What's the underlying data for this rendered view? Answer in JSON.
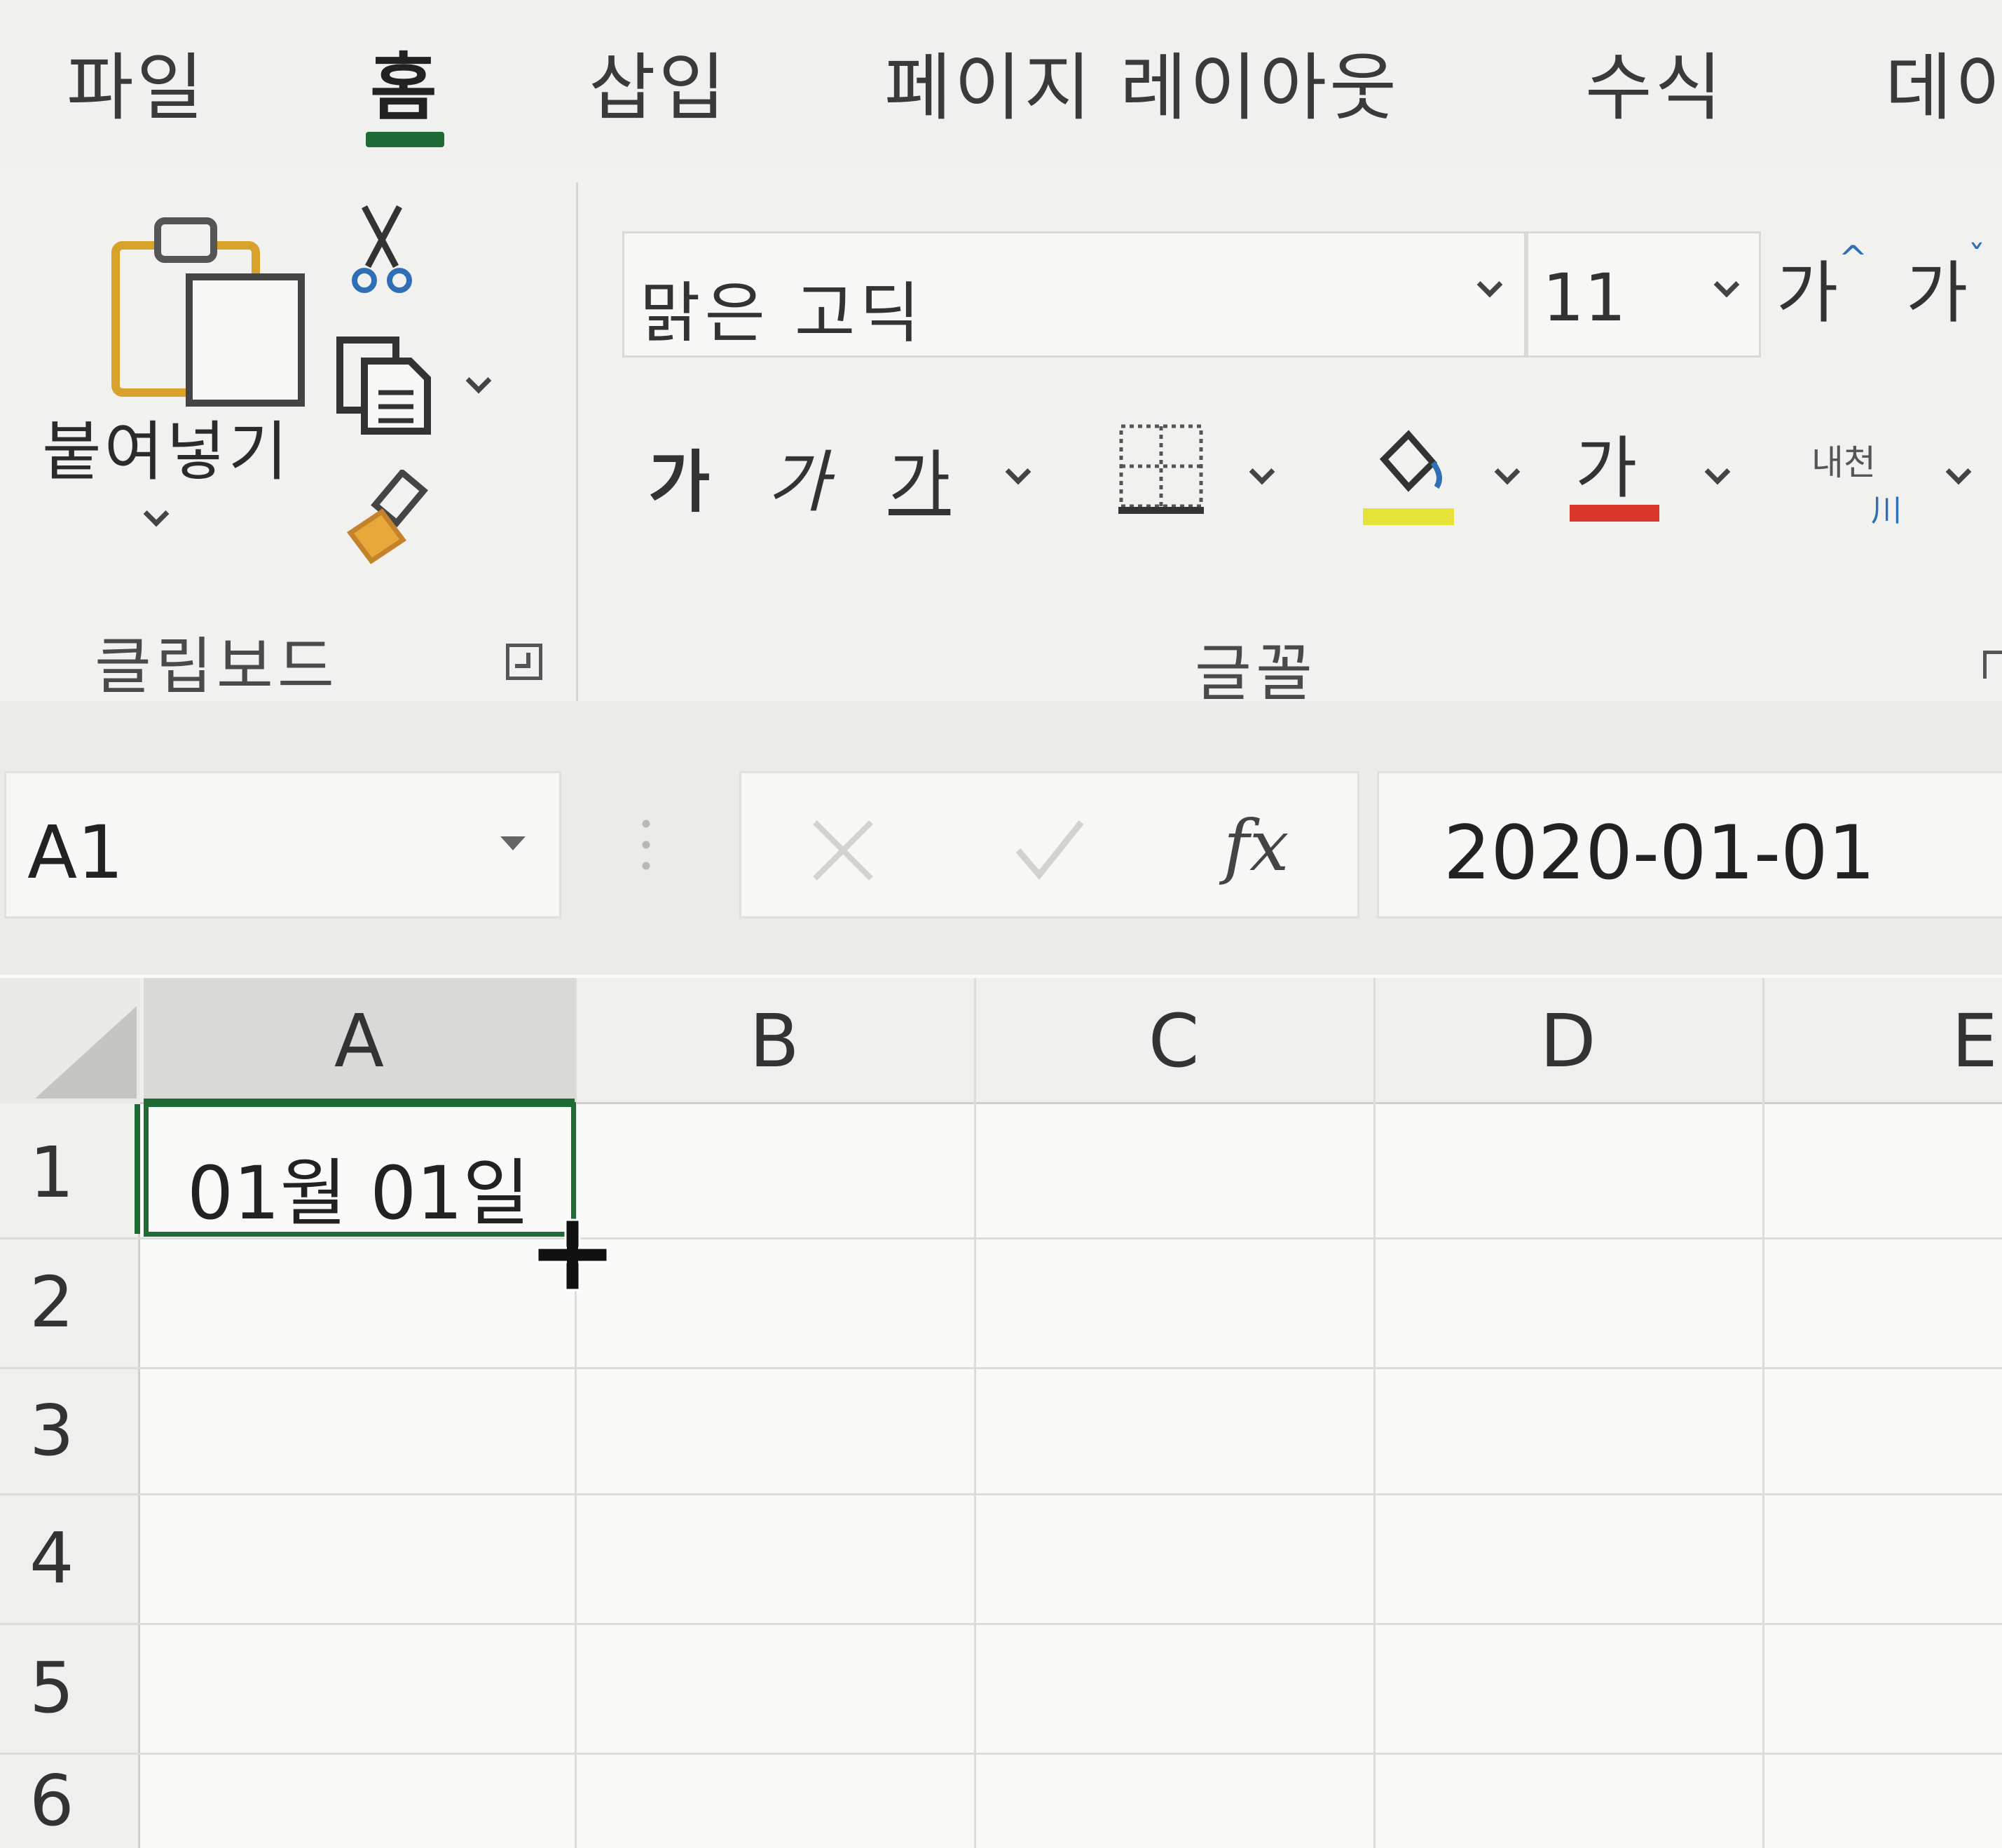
{
  "tabs": [
    {
      "label": "파일",
      "active": false
    },
    {
      "label": "홈",
      "active": true
    },
    {
      "label": "삽입",
      "active": false
    },
    {
      "label": "페이지 레이아웃",
      "active": false
    },
    {
      "label": "수식",
      "active": false
    },
    {
      "label": "데이",
      "active": false
    }
  ],
  "clipboard": {
    "paste_label": "붙여넣기",
    "group_label": "클립보드",
    "icons": [
      "paste-icon",
      "cut-icon",
      "copy-icon",
      "format-painter-icon"
    ]
  },
  "font": {
    "font_name": "맑은 고딕",
    "font_size": "11",
    "grow_label": "가",
    "shrink_label": "가",
    "bold_label": "가",
    "italic_label": "가",
    "underline_label": "가",
    "font_color_label": "가",
    "phonetic_label": "내천",
    "group_label": "글꼴",
    "fill_color": "#e6e23a",
    "font_color": "#d9362b"
  },
  "formula_bar": {
    "name_box": "A1",
    "formula_value": "2020-01-01",
    "fx_label": "fx"
  },
  "sheet": {
    "columns": [
      "A",
      "B",
      "C",
      "D",
      "E"
    ],
    "rows": [
      "1",
      "2",
      "3",
      "4",
      "5",
      "6"
    ],
    "selected_cell": "A1",
    "cell_a1": "01월 01일",
    "selection_color": "#1e6b36"
  }
}
